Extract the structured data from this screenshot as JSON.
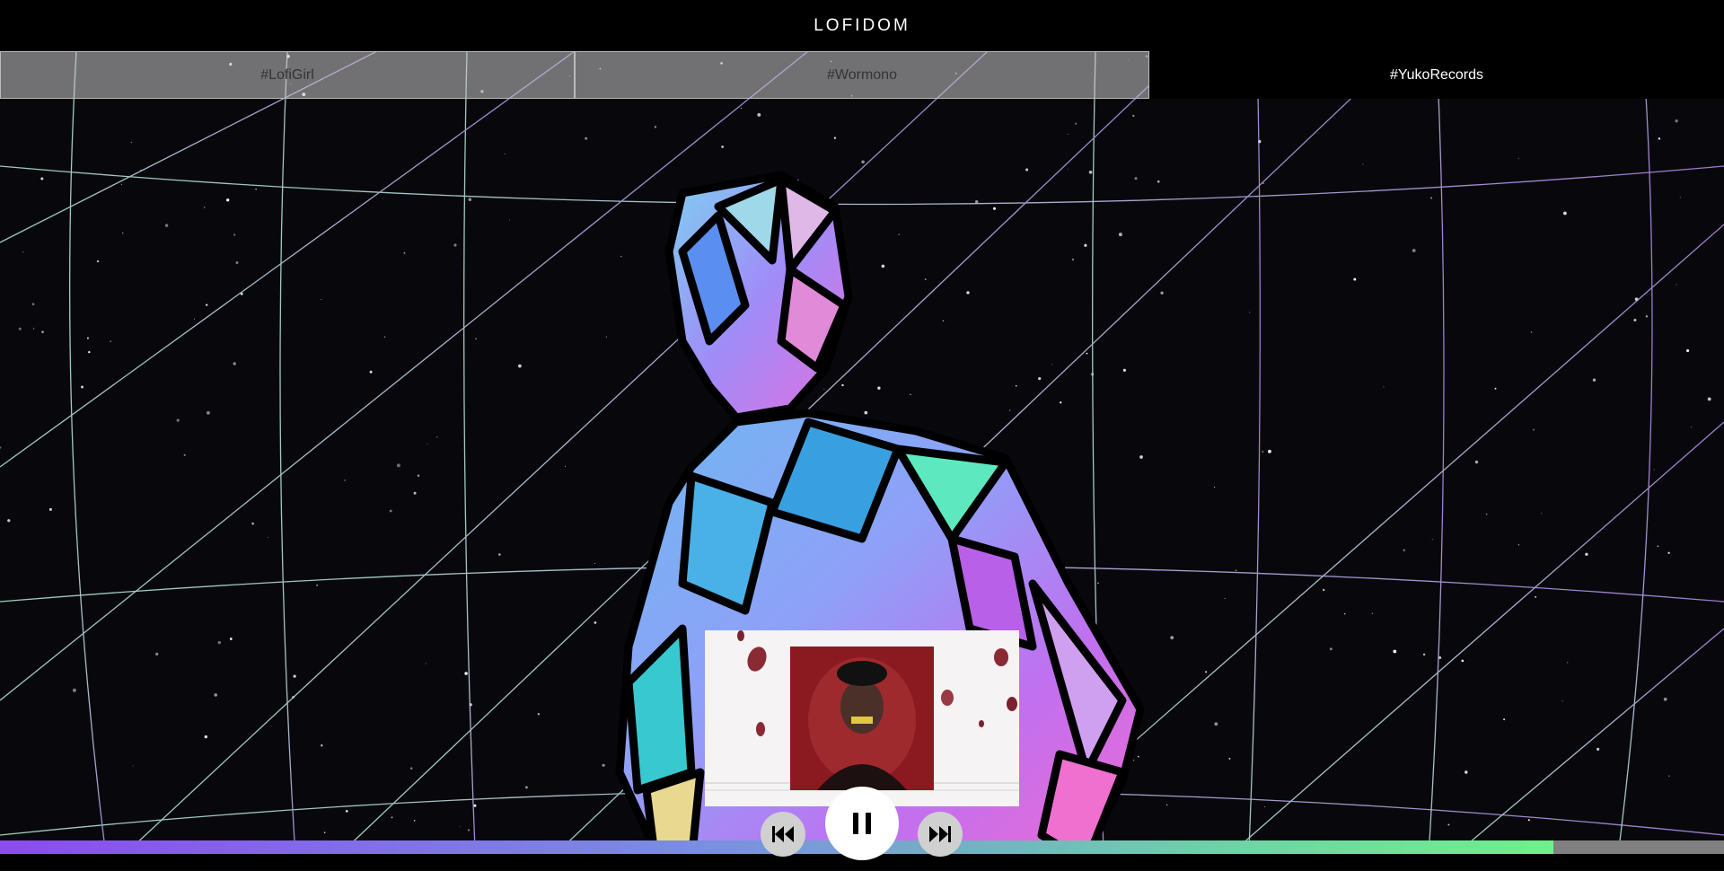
{
  "app": {
    "title": "LOFIDOM"
  },
  "tabs": [
    {
      "label": "#LofiGirl",
      "active": false
    },
    {
      "label": "#Wormono",
      "active": false
    },
    {
      "label": "#YukoRecords",
      "active": true
    }
  ],
  "player": {
    "progress_fraction": 0.901,
    "controls": {
      "prev_icon": "skip-back-icon",
      "play_pause_icon": "pause-icon",
      "next_icon": "skip-forward-icon"
    }
  },
  "colors": {
    "progress_start": "#8a4cf0",
    "progress_end": "#6ff08a",
    "active_tab_bg": "#000000"
  }
}
